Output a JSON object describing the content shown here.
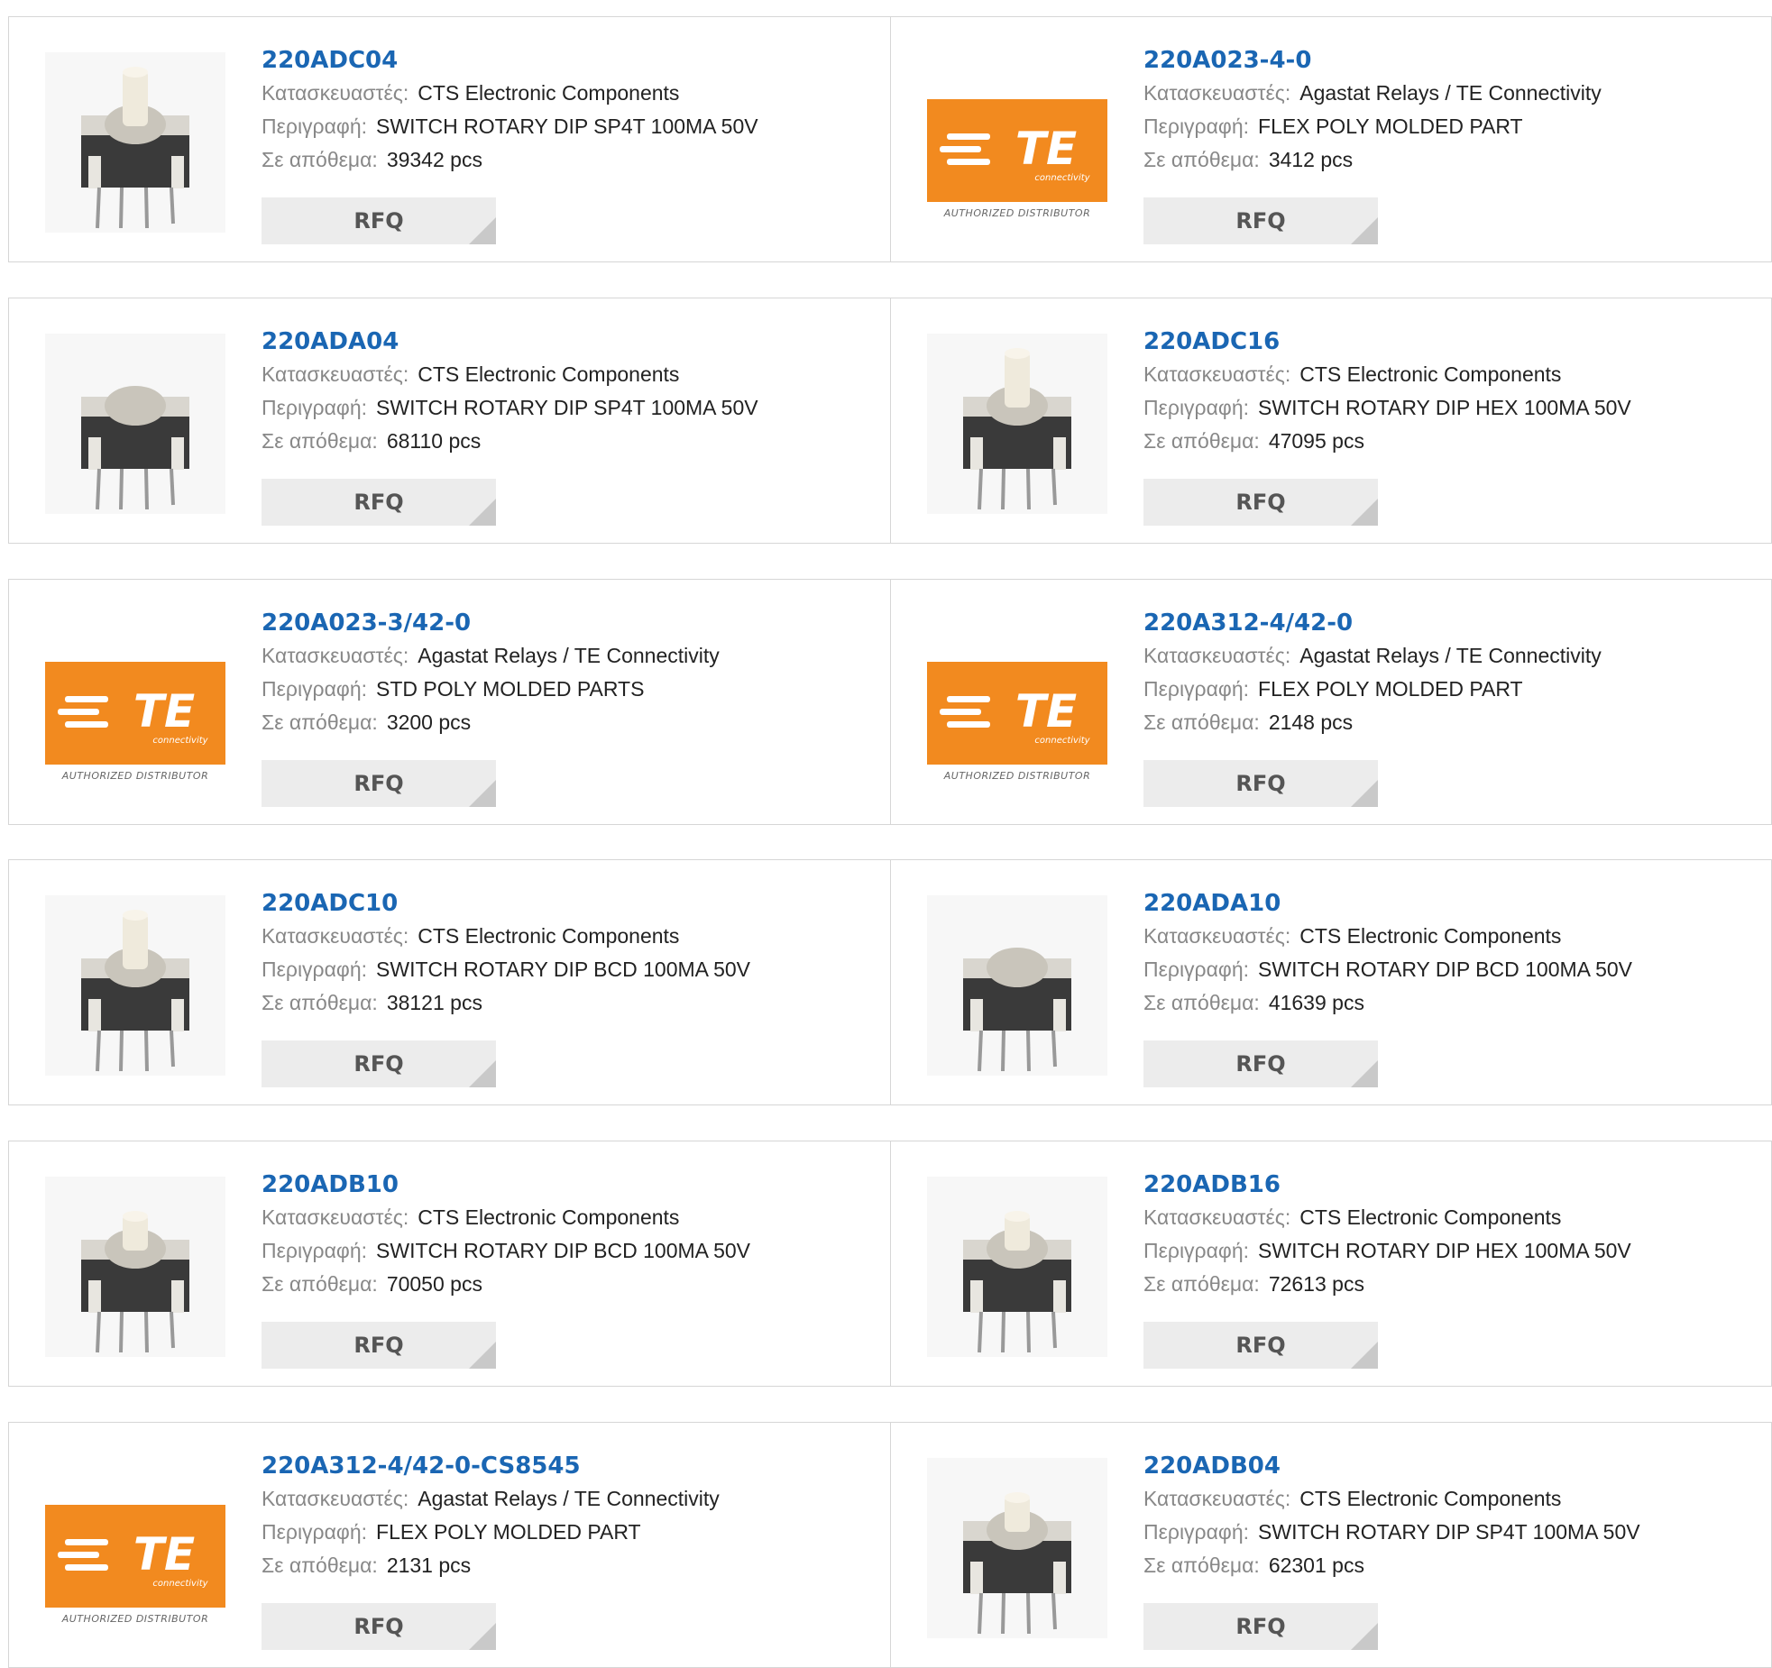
{
  "labels": {
    "manufacturer": "Κατασκευαστές:",
    "description": "Περιγραφή:",
    "stock": "Σε απόθεμα:",
    "rfq": "RFQ"
  },
  "brand_logo": {
    "te_text": "TE",
    "te_sub": "connectivity",
    "te_tagline": "AUTHORIZED DISTRIBUTOR",
    "te_color": "#f28a1f"
  },
  "products": [
    {
      "part": "220ADC04",
      "manufacturer": "CTS Electronic Components",
      "description": "SWITCH ROTARY DIP SP4T 100MA 50V",
      "stock": "39342 pcs",
      "image": "rotary-switch-tall-knob"
    },
    {
      "part": "220A023-4-0",
      "manufacturer": "Agastat Relays / TE Connectivity",
      "description": "FLEX POLY MOLDED PART",
      "stock": "3412 pcs",
      "image": "te-logo"
    },
    {
      "part": "220ADA04",
      "manufacturer": "CTS Electronic Components",
      "description": "SWITCH ROTARY DIP SP4T 100MA 50V",
      "stock": "68110 pcs",
      "image": "rotary-switch-flat"
    },
    {
      "part": "220ADC16",
      "manufacturer": "CTS Electronic Components",
      "description": "SWITCH ROTARY DIP HEX 100MA 50V",
      "stock": "47095 pcs",
      "image": "rotary-switch-tall-knob"
    },
    {
      "part": "220A023-3/42-0",
      "manufacturer": "Agastat Relays / TE Connectivity",
      "description": "STD POLY MOLDED PARTS",
      "stock": "3200 pcs",
      "image": "te-logo"
    },
    {
      "part": "220A312-4/42-0",
      "manufacturer": "Agastat Relays / TE Connectivity",
      "description": "FLEX POLY MOLDED PART",
      "stock": "2148 pcs",
      "image": "te-logo"
    },
    {
      "part": "220ADC10",
      "manufacturer": "CTS Electronic Components",
      "description": "SWITCH ROTARY DIP BCD 100MA 50V",
      "stock": "38121 pcs",
      "image": "rotary-switch-tall-knob"
    },
    {
      "part": "220ADA10",
      "manufacturer": "CTS Electronic Components",
      "description": "SWITCH ROTARY DIP BCD 100MA 50V",
      "stock": "41639 pcs",
      "image": "rotary-switch-flat"
    },
    {
      "part": "220ADB10",
      "manufacturer": "CTS Electronic Components",
      "description": "SWITCH ROTARY DIP BCD 100MA 50V",
      "stock": "70050 pcs",
      "image": "rotary-switch-mid-knob"
    },
    {
      "part": "220ADB16",
      "manufacturer": "CTS Electronic Components",
      "description": "SWITCH ROTARY DIP HEX 100MA 50V",
      "stock": "72613 pcs",
      "image": "rotary-switch-mid-knob"
    },
    {
      "part": "220A312-4/42-0-CS8545",
      "manufacturer": "Agastat Relays / TE Connectivity",
      "description": "FLEX POLY MOLDED PART",
      "stock": "2131 pcs",
      "image": "te-logo"
    },
    {
      "part": "220ADB04",
      "manufacturer": "CTS Electronic Components",
      "description": "SWITCH ROTARY DIP SP4T 100MA 50V",
      "stock": "62301 pcs",
      "image": "rotary-switch-mid-knob"
    }
  ]
}
